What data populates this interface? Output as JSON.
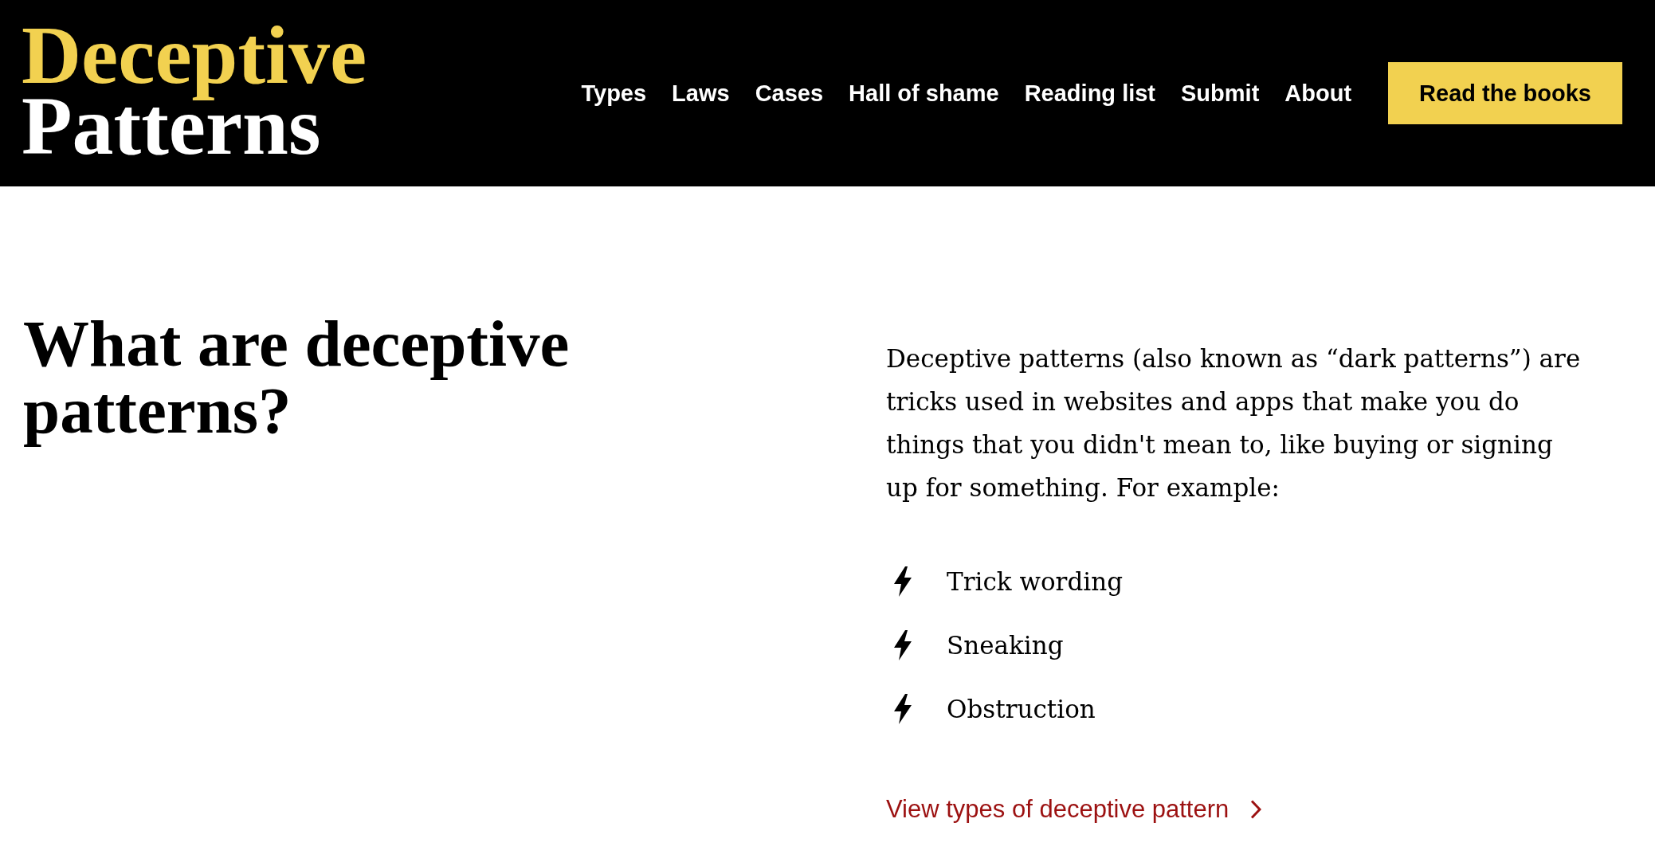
{
  "header": {
    "logo": {
      "line_1": "Deceptive",
      "line_2": "Patterns"
    },
    "nav": [
      "Types",
      "Laws",
      "Cases",
      "Hall of shame",
      "Reading list",
      "Submit",
      "About"
    ],
    "cta_button": "Read the books"
  },
  "intro": {
    "heading": "What are deceptive patterns?",
    "paragraph": "Deceptive patterns (also known as “dark patterns”) are tricks used in websites and apps that make you do things that you didn't mean to, like buying or signing up for something. For example:",
    "examples": [
      "Trick wording",
      "Sneaking",
      "Obstruction"
    ],
    "link": "View types of deceptive pattern"
  }
}
